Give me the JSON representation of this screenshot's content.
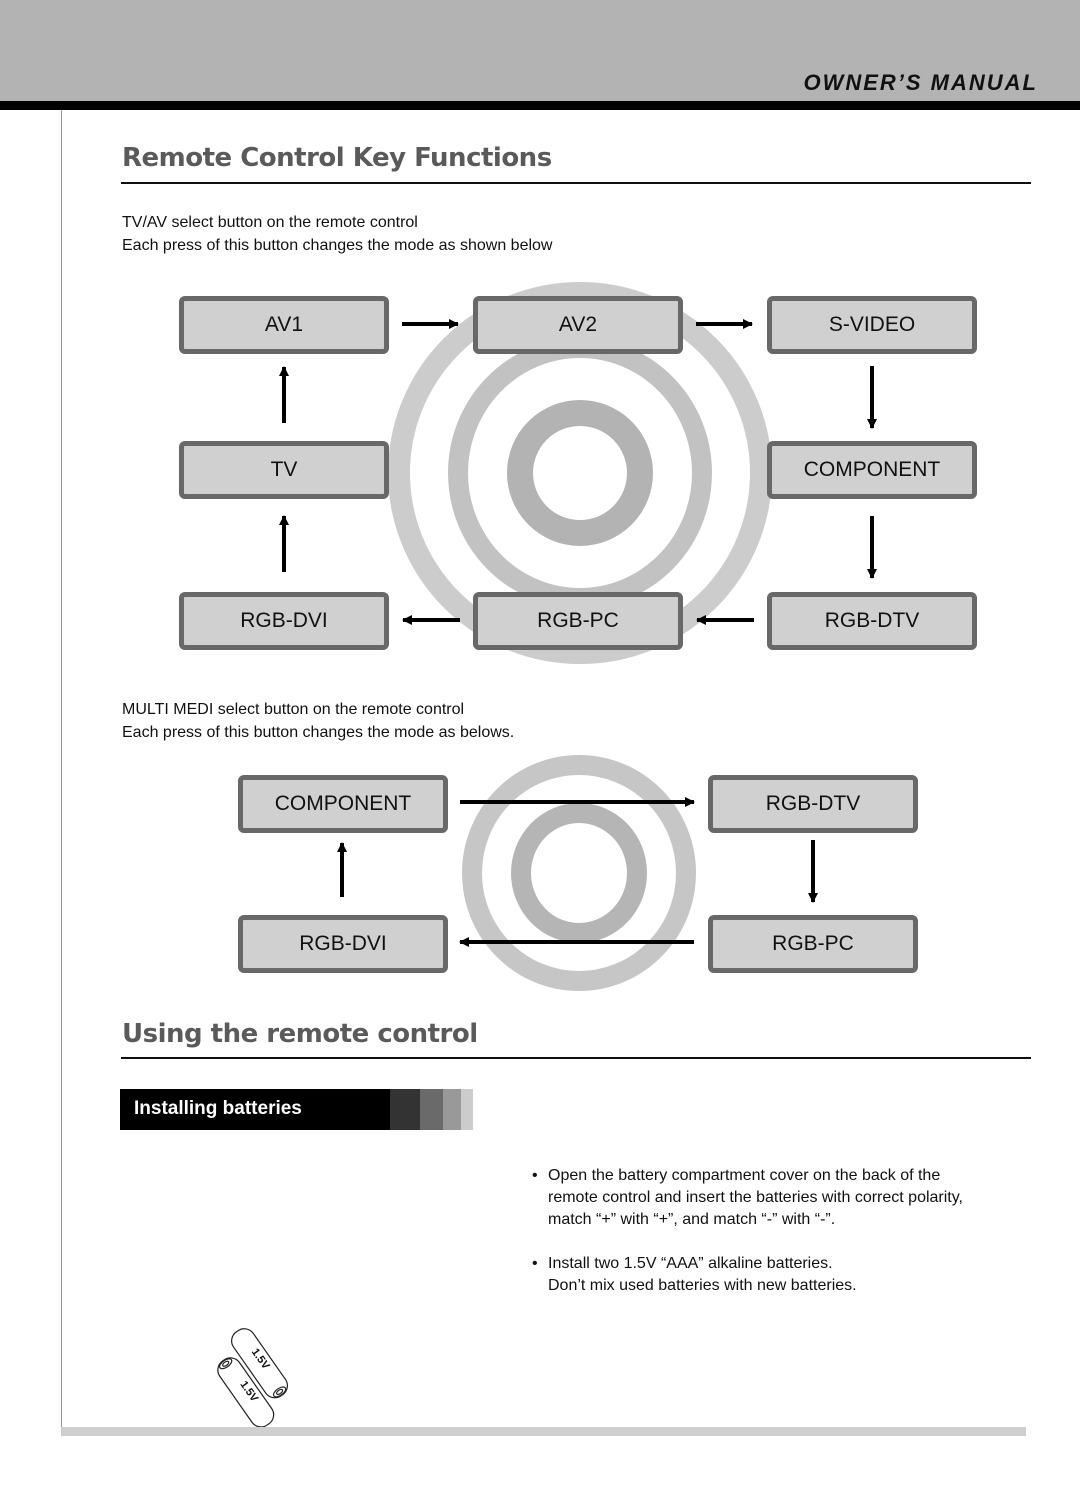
{
  "header": {
    "title": "OWNER’S MANUAL"
  },
  "section1": {
    "title": "Remote Control Key Functions",
    "intro_line1": "TV/AV select button on the remote control",
    "intro_line2": "Each press of this button changes the mode as shown below",
    "modes": {
      "av1": "AV1",
      "av2": "AV2",
      "svideo": "S-VIDEO",
      "tv": "TV",
      "component": "COMPONENT",
      "rgb_dvi": "RGB-DVI",
      "rgb_pc": "RGB-PC",
      "rgb_dtv": "RGB-DTV"
    },
    "cycle_order": [
      "TV",
      "AV1",
      "AV2",
      "S-VIDEO",
      "COMPONENT",
      "RGB-DTV",
      "RGB-PC",
      "RGB-DVI"
    ]
  },
  "section2": {
    "intro_line1": "MULTI MEDI select button on the remote control",
    "intro_line2": "Each press of this button changes the mode as belows.",
    "modes": {
      "component": "COMPONENT",
      "rgb_dtv": "RGB-DTV",
      "rgb_pc": "RGB-PC",
      "rgb_dvi": "RGB-DVI"
    },
    "cycle_order": [
      "COMPONENT",
      "RGB-DTV",
      "RGB-PC",
      "RGB-DVI"
    ]
  },
  "section3": {
    "title": "Using the remote control",
    "subheading": "Installing batteries",
    "bullets": [
      {
        "marker": "•",
        "lines": [
          "Open the battery compartment cover on the back of the",
          "remote control and insert the batteries with correct polarity,",
          "match “+” with “+”, and match “-” with “-”."
        ]
      },
      {
        "marker": "•",
        "lines": [
          "Install two 1.5V “AAA” alkaline batteries.",
          "Don’t mix used batteries with new batteries."
        ]
      }
    ],
    "battery_label": "1.5V"
  }
}
